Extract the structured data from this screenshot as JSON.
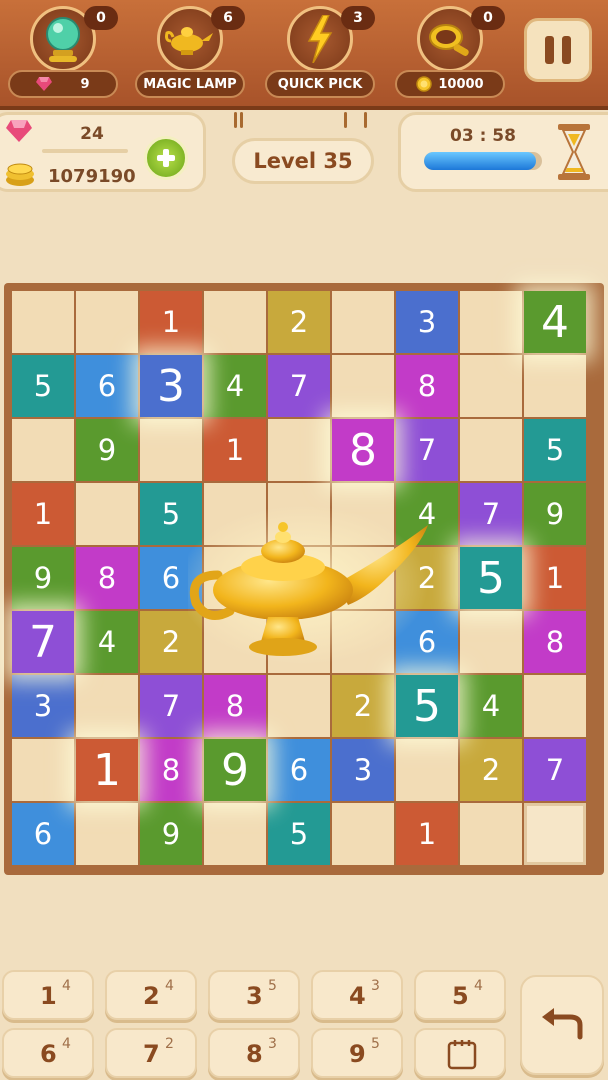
{
  "powerups": [
    {
      "name": "crystal-ball",
      "count": "0",
      "label": "9",
      "icon": "crystal-ball-icon"
    },
    {
      "name": "magic-lamp",
      "count": "6",
      "label": "MAGIC LAMP",
      "icon": "magic-lamp-icon"
    },
    {
      "name": "quick-pick",
      "count": "3",
      "label": "QUICK PICK",
      "icon": "lightning-pencil-icon"
    },
    {
      "name": "magnifier",
      "count": "0",
      "label": "10000",
      "icon": "magnifier-icon"
    }
  ],
  "gems": "24",
  "coins": "1079190",
  "level": "Level  35",
  "timer": "03 : 58",
  "timer_progress": 0.95,
  "colors": {
    "red": "#cc5a34",
    "yellow": "#c8a93c",
    "blue": "#4b6fce",
    "purple": "#8e4fd6",
    "magenta": "#c23bc8",
    "teal": "#239a94",
    "green": "#5a9a2e",
    "lightblue": "#3f8fdc",
    "cellEmpty": "#f2dcb5",
    "boardFrame": "#a96a3c"
  },
  "grid": [
    [
      "",
      "",
      "1:red",
      "",
      "2:yellow",
      "",
      "3:blue",
      "",
      "4:green:big"
    ],
    [
      "5:teal",
      "6:lightblue",
      "3:blue:big",
      "4:green",
      "7:purple",
      "",
      "8:magenta",
      "",
      ""
    ],
    [
      "",
      "9:green",
      "",
      "1:red",
      "",
      "8:magenta:big",
      "7:purple",
      "",
      "5:teal"
    ],
    [
      "1:red",
      "",
      "5:teal",
      "",
      "",
      "",
      "4:green",
      "7:purple",
      "9:green"
    ],
    [
      "9:green",
      "8:magenta",
      "6:lightblue",
      "",
      "",
      "",
      "2:yellow",
      "5:teal:big",
      "1:red"
    ],
    [
      "7:purple:big",
      "4:green",
      "2:yellow",
      "",
      "",
      "",
      "6:lightblue",
      "",
      "8:magenta"
    ],
    [
      "3:blue",
      "",
      "7:purple",
      "8:magenta",
      "",
      "2:yellow",
      "5:teal:big",
      "4:green",
      ""
    ],
    [
      "",
      "1:red:big",
      "8:magenta",
      "9:green:big",
      "6:lightblue",
      "3:blue",
      "",
      "2:yellow",
      "7:purple"
    ],
    [
      "6:lightblue",
      "",
      "9:green",
      "",
      "5:teal",
      "",
      "1:red",
      "",
      "sel"
    ]
  ],
  "numpad": [
    {
      "num": "1",
      "count": "4"
    },
    {
      "num": "2",
      "count": "4"
    },
    {
      "num": "3",
      "count": "5"
    },
    {
      "num": "4",
      "count": "3"
    },
    {
      "num": "5",
      "count": "4"
    },
    {
      "num": "6",
      "count": "4"
    },
    {
      "num": "7",
      "count": "2"
    },
    {
      "num": "8",
      "count": "3"
    },
    {
      "num": "9",
      "count": "5"
    },
    {
      "num": "",
      "count": ""
    }
  ]
}
